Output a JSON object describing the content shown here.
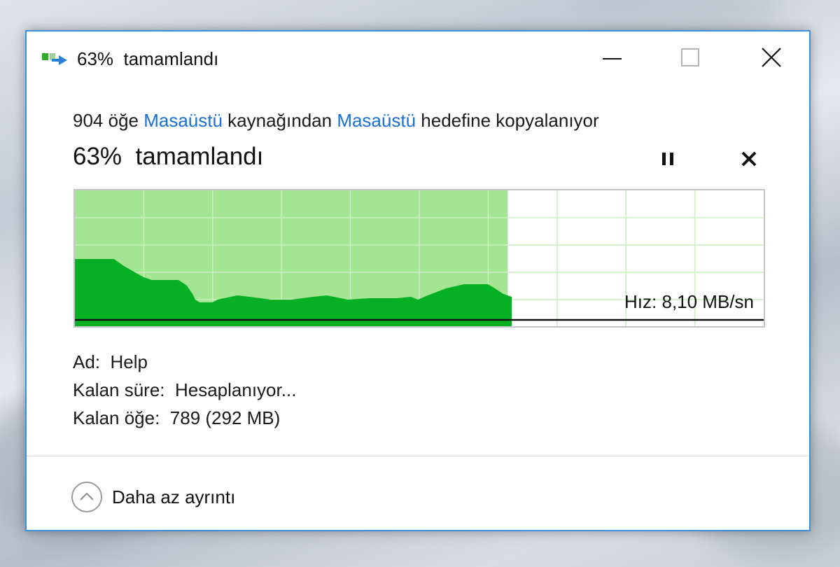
{
  "window": {
    "title": "63%  tamamlandı",
    "controls": {
      "minimize": "minimize",
      "maximize": "maximize",
      "close": "close"
    }
  },
  "copy": {
    "count_text": "904 öğe ",
    "source": "Masaüstü",
    "middle_text": " kaynağından ",
    "destination": "Masaüstü",
    "end_text": " hedefine kopyalanıyor",
    "progress_title": "63%  tamamlandı",
    "progress_percent": 63
  },
  "graph": {
    "speed_label": "Hız: 8,10 MB/sn",
    "colors": {
      "done_fill": "#a4e593",
      "speed_fill": "#06b025",
      "grid": "#cbeec3",
      "baseline": "#111111"
    }
  },
  "details": {
    "name_label": "Ad:",
    "name_value": "Help",
    "time_label": "Kalan süre:",
    "time_value": "Hesaplanıyor...",
    "items_label": "Kalan öğe:",
    "items_value": "789 (292 MB)"
  },
  "footer": {
    "label": "Daha az ayrıntı",
    "icon": "chevron-up-circle-icon"
  }
}
